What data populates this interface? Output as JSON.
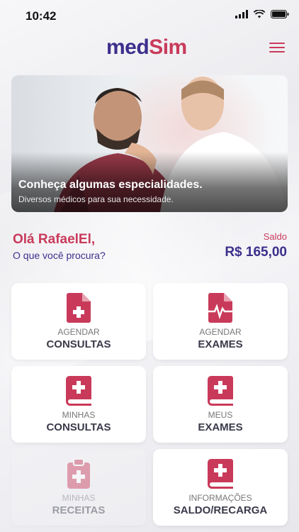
{
  "status_bar": {
    "time": "10:42"
  },
  "header": {
    "logo_part1": "med",
    "logo_part2": "Sim"
  },
  "banner": {
    "title": "Conheça algumas especialidades.",
    "subtitle": "Diversos médicos para sua necessidade."
  },
  "greeting": {
    "title": "Olá RafaelEl,",
    "subtitle": "O que você procura?"
  },
  "balance": {
    "label": "Saldo",
    "value": "R$ 165,00"
  },
  "menu_cards": [
    {
      "line1": "AGENDAR",
      "line2": "CONSULTAS",
      "icon": "file-medical-icon"
    },
    {
      "line1": "AGENDAR",
      "line2": "EXAMES",
      "icon": "file-pulse-icon"
    },
    {
      "line1": "MINHAS",
      "line2": "CONSULTAS",
      "icon": "medical-book-icon"
    },
    {
      "line1": "MEUS",
      "line2": "EXAMES",
      "icon": "medical-book-icon"
    },
    {
      "line1": "MINHAS",
      "line2": "RECEITAS",
      "icon": "clipboard-medical-icon"
    },
    {
      "line1": "INFORMAÇÕES",
      "line2": "SALDO/RECARGA",
      "icon": "medical-book-icon"
    }
  ],
  "colors": {
    "accent": "#c93a5a",
    "brand": "#3c2f8c"
  }
}
